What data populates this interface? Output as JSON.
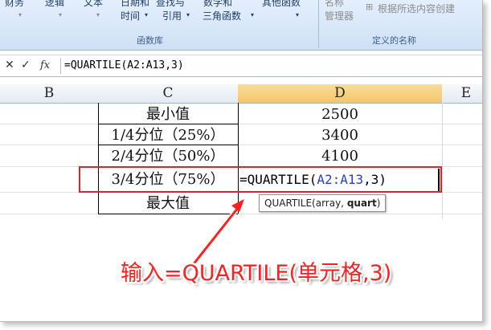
{
  "ribbon": {
    "top_items": [
      "财务",
      "逻辑",
      "文本",
      "日期和",
      "查找与",
      "数学和",
      "其他函数",
      "名称"
    ],
    "row2": {
      "time": "时间",
      "ref": "引用",
      "trig": "三角函数"
    },
    "name_manager": "管理器",
    "create_from_sel": "根据所选内容创建",
    "group_funclib": "函数库",
    "group_names": "定义的名称"
  },
  "formula_bar": {
    "cancel": "✕",
    "enter": "✓",
    "fx": "fx",
    "formula": "=QUARTILE(A2:A13,3)"
  },
  "columns": [
    "B",
    "C",
    "D",
    "E"
  ],
  "rows": [
    {
      "label": "最小值",
      "value": "2500"
    },
    {
      "label": "1/4分位（25%）",
      "value": "3400"
    },
    {
      "label": "2/4分位（50%）",
      "value": "4100"
    },
    {
      "label": "3/4分位（75%）",
      "value": ""
    },
    {
      "label": "最大值",
      "value": ""
    }
  ],
  "editing": {
    "prefix": "=QUARTILE(",
    "range": "A2:A13",
    "comma": ",",
    "arg": "3",
    "suffix": ")"
  },
  "tooltip": {
    "text": "QUARTILE(array, ",
    "bold": "quart",
    "end": ")"
  },
  "annotation": "输入=QUARTILE(单元格,3)",
  "colors": {
    "accent_red": "#d9252b",
    "annotation_red": "#ff1f1f",
    "ref_blue": "#2a3fd4"
  }
}
